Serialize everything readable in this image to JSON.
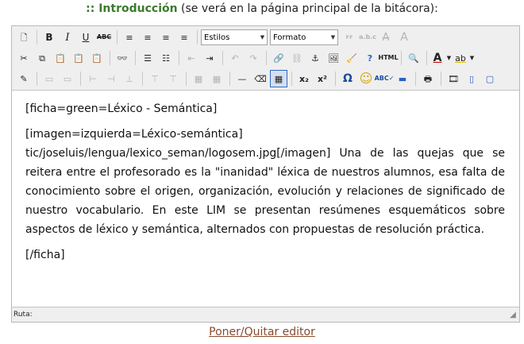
{
  "heading": {
    "accent": ":: Introducción",
    "rest": " (se verá en la página principal de la bitácora):"
  },
  "toolbar": {
    "row1": {
      "new_page": "🗋",
      "bold": "B",
      "italic": "I",
      "underline": "U",
      "strike": "ABC",
      "align_left": "≡",
      "align_center": "≡",
      "align_right": "≡",
      "align_justify": "≡",
      "styles_value": "Estilos",
      "format_value": "Formato",
      "font_size_down": "ꜰꜰ",
      "abc_small": "a.b.c",
      "font_color_a": "A",
      "font_size_a": "A"
    },
    "row2": {
      "cut": "✂",
      "copy": "⧉",
      "paste": "📋",
      "paste_text": "📋",
      "paste_word": "📋",
      "find": "👓",
      "bullets": "☰",
      "numbers": "☷",
      "outdent": "⇤",
      "indent": "⇥",
      "undo": "↶",
      "redo": "↷",
      "link": "🔗",
      "unlink": "⛓",
      "anchor": "⚓",
      "image": "🖼",
      "cleanup": "🧹",
      "help": "?",
      "html": "HTML",
      "preview": "🔍",
      "font_color": "A",
      "highlight": "ab"
    },
    "row3": {
      "edit": "✎",
      "t1": "▭",
      "t2": "▭",
      "t3": "⊢",
      "t4": "⊣",
      "t5": "⊥",
      "t6": "⊤",
      "t7": "⊤",
      "t8": "▦",
      "t9": "▦",
      "hr": "—",
      "eraser": "⌫",
      "table": "▦",
      "subscript": "x₂",
      "superscript": "x²",
      "omega": "Ω",
      "smiley": "☺",
      "spell": "ABC✓",
      "dash": "▬",
      "print": "🖶",
      "movie": "🎞",
      "layer": "▯",
      "window": "▢"
    }
  },
  "content": {
    "p1": "[ficha=green=Léxico - Semántica]",
    "p2": "[imagen=izquierda=Léxico-semántica] tic/joseluis/lengua/lexico_seman/logosem.jpg[/imagen] Una de las quejas que se reitera entre el profesorado es la \"inanidad\" léxica de nuestros alumnos, esa falta de conocimiento sobre el origen, organización, evolución y relaciones de significado de nuestro vocabulario. En este LIM se presentan resúmenes esquemáticos sobre aspectos de léxico y semántica, alternados con propuestas de resolución práctica.",
    "p3": "[/ficha]"
  },
  "status": {
    "path_label": "Ruta:"
  },
  "toggle_link": "Poner/Quitar editor",
  "colors": {
    "accent": "#3c7a2c",
    "link": "#8a4a2c",
    "toolbar_bg": "#efefef",
    "active": "#316ac5"
  }
}
